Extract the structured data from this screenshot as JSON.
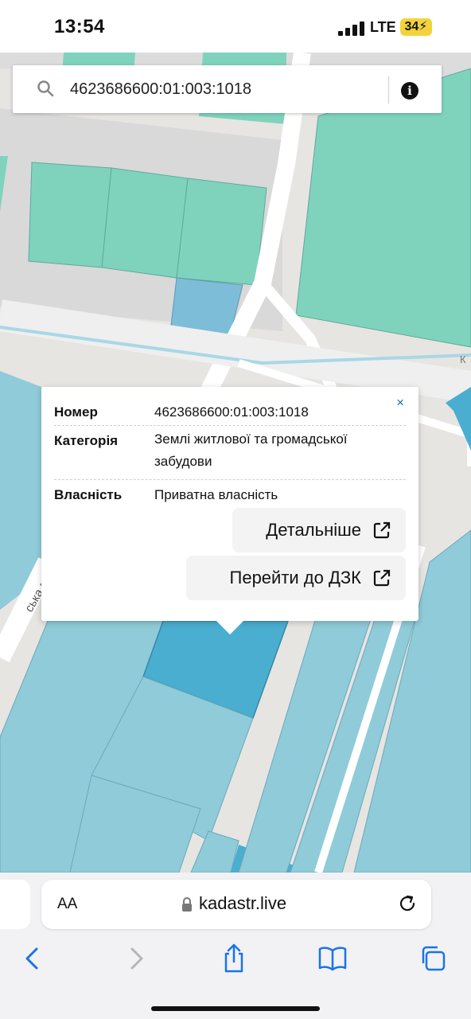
{
  "status_bar": {
    "time": "13:54",
    "network": "LTE",
    "battery": "34"
  },
  "search": {
    "value": "4623686600:01:003:1018",
    "icon": "search-icon",
    "info_icon": "info-icon"
  },
  "map": {
    "street_label_left": "ська вул",
    "street_label_right": "К"
  },
  "popup": {
    "rows": [
      {
        "label": "Номер",
        "value": "4623686600:01:003:1018"
      },
      {
        "label": "Категорія",
        "value": "Землі житлової та громадської забудови"
      },
      {
        "label": "Власність",
        "value": "Приватна власність"
      }
    ],
    "close": "×",
    "buttons": {
      "details": "Детальніше",
      "goto": "Перейти до ДЗК"
    }
  },
  "browser": {
    "text_size": "AA",
    "url": "kadastr.live",
    "nav_icons": [
      "back-icon",
      "forward-icon",
      "share-icon",
      "bookmarks-icon",
      "tabs-icon"
    ]
  },
  "colors": {
    "parcel_green": "#7fd3bd",
    "parcel_blue": "#8fcbd8",
    "parcel_selected": "#4aaed0",
    "road_white": "#ffffff",
    "map_bg": "#e7e5e1",
    "link_blue": "#1a6fb5"
  }
}
